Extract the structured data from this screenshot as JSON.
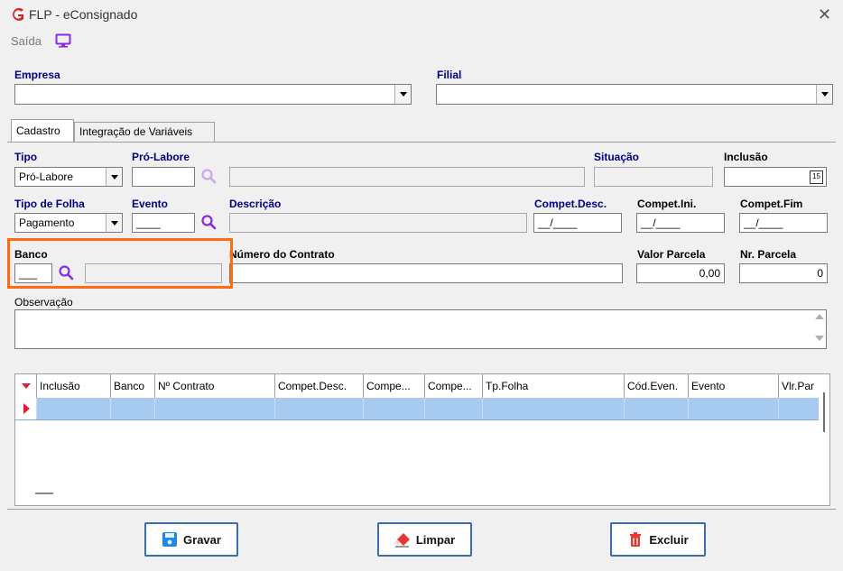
{
  "window": {
    "title": "FLP - eConsignado",
    "close_glyph": "✕"
  },
  "menu": {
    "saida_label": "Saída"
  },
  "empresa": {
    "label": "Empresa",
    "value": ""
  },
  "filial": {
    "label": "Filial",
    "value": ""
  },
  "tabs": [
    {
      "label": "Cadastro",
      "active": true
    },
    {
      "label": "Integração de Variáveis",
      "active": false
    }
  ],
  "form": {
    "tipo": {
      "label": "Tipo",
      "value": "Pró-Labore"
    },
    "pro_labore": {
      "label": "Pró-Labore",
      "value": "",
      "descricao": ""
    },
    "situacao": {
      "label": "Situação",
      "value": ""
    },
    "inclusao": {
      "label": "Inclusão",
      "value": "",
      "calendar_glyph": "15"
    },
    "tipo_folha": {
      "label": "Tipo de Folha",
      "value": "Pagamento"
    },
    "evento": {
      "label": "Evento",
      "value": "____"
    },
    "descricao": {
      "label": "Descrição",
      "value": ""
    },
    "compet_desc": {
      "label": "Compet.Desc.",
      "value": "__/____"
    },
    "compet_ini": {
      "label": "Compet.Ini.",
      "value": "__/____"
    },
    "compet_fim": {
      "label": "Compet.Fim",
      "value": "__/____"
    },
    "banco": {
      "label": "Banco",
      "value": "___",
      "nome": ""
    },
    "numero_contrato": {
      "label": "Número do Contrato",
      "value": ""
    },
    "valor_parcela": {
      "label": "Valor Parcela",
      "value": "0,00"
    },
    "nr_parcela": {
      "label": "Nr. Parcela",
      "value": "0"
    },
    "observacao": {
      "label": "Observação",
      "value": ""
    }
  },
  "grid": {
    "columns": [
      "Inclusão",
      "Banco",
      "Nº Contrato",
      "Compet.Desc.",
      "Compe...",
      "Compe...",
      "Tp.Folha",
      "Cód.Even.",
      "Evento",
      "Vlr.Par"
    ],
    "selected_row_color": "#a6caf0"
  },
  "buttons": {
    "gravar": "Gravar",
    "limpar": "Limpar",
    "excluir": "Excluir"
  },
  "colors": {
    "label_blue": "#000080",
    "search_purple": "#8a2be2",
    "highlight_orange": "#ff6a13",
    "button_border": "#3c6bb0"
  }
}
